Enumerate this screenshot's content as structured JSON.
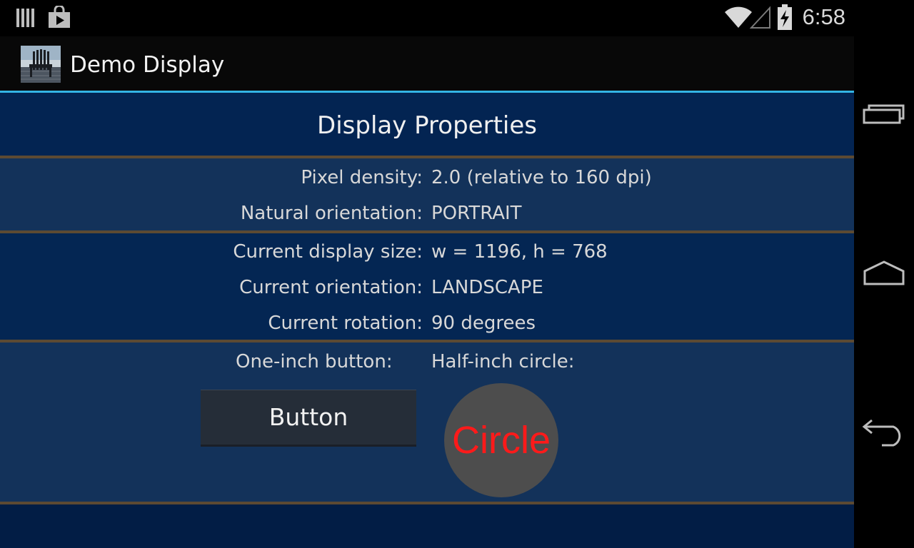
{
  "status_bar": {
    "time": "6:58",
    "left_icons": [
      "notification-bars-icon",
      "play-store-bag-icon"
    ],
    "right_icons": [
      "wifi-icon",
      "cell-signal-icon",
      "battery-charging-icon"
    ]
  },
  "action_bar": {
    "title": "Demo Display",
    "icon": "app-chair-icon",
    "underline_color": "#33b5e5"
  },
  "header": {
    "title": "Display Properties"
  },
  "natural": {
    "rows": [
      {
        "label": "Pixel density:",
        "value": "2.0 (relative to 160 dpi)"
      },
      {
        "label": "Natural orientation:",
        "value": "PORTRAIT"
      }
    ]
  },
  "current": {
    "rows": [
      {
        "label": "Current display size:",
        "value": "w = 1196, h = 768"
      },
      {
        "label": "Current orientation:",
        "value": "LANDSCAPE"
      },
      {
        "label": "Current rotation:",
        "value": "90 degrees"
      }
    ]
  },
  "demo": {
    "button_label": "One-inch button:",
    "circle_label": "Half-inch circle:",
    "button_text": "Button",
    "circle_text": "Circle",
    "circle_text_color": "#ff1a1a"
  },
  "nav_bar": {
    "buttons": [
      "recent-apps-icon",
      "home-icon",
      "back-icon"
    ]
  }
}
